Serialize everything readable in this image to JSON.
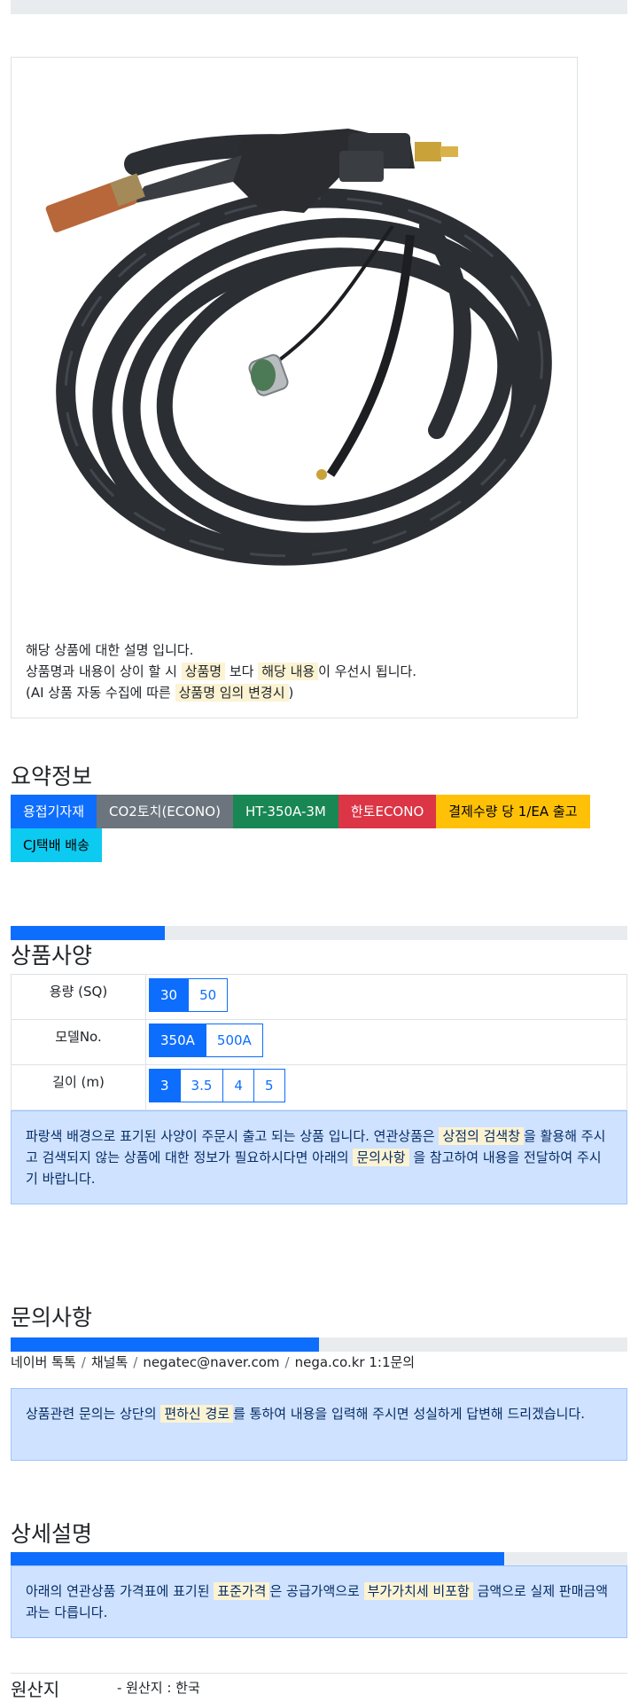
{
  "product": {
    "image_alt": "MIG welding torch with coiled black hose",
    "notice_line1": "해당 상품에 대한 설명 입니다.",
    "notice_line2_pre": "상품명과 내용이 상이 할 시 ",
    "notice_line2_mark1": "상품명",
    "notice_line2_mid": " 보다 ",
    "notice_line2_mark2": "해당 내용",
    "notice_line2_post": "이 우선시 됩니다.",
    "notice_line3_pre": "(AI 상품 자동 수집에 따른 ",
    "notice_line3_mark": "상품명 임의 변경시",
    "notice_line3_post": ")"
  },
  "summary": {
    "title": "요약정보",
    "badges": [
      {
        "label": "용접기자재",
        "color": "#0d6efd"
      },
      {
        "label": "CO2토치(ECONO)",
        "color": "#6c757d"
      },
      {
        "label": "HT-350A-3M",
        "color": "#198754"
      },
      {
        "label": "한토ECONO",
        "color": "#dc3545"
      },
      {
        "label": "결제수량 당 1/EA 출고",
        "color": "#ffc107"
      },
      {
        "label": "CJ택배 배송",
        "color": "#0dcaf0"
      }
    ]
  },
  "spec": {
    "title": "상품사양",
    "progress_fraction": 0.25,
    "rows": [
      {
        "label": "용량 (SQ)",
        "options": [
          "30",
          "50"
        ],
        "selected": "30"
      },
      {
        "label": "모델No.",
        "options": [
          "350A",
          "500A"
        ],
        "selected": "350A"
      },
      {
        "label": "길이 (m)",
        "options": [
          "3",
          "3.5",
          "4",
          "5"
        ],
        "selected": "3"
      }
    ],
    "notice_pre": "파랑색 배경으로 표기된 사양이 주문시 출고 되는 상품 입니다. 연관상품은 ",
    "notice_mark1": "상점의 검색창",
    "notice_mid": "을 활용해 주시고 검색되지 않는 상품에 대한 정보가 필요하시다면 아래의 ",
    "notice_mark2": "문의사항",
    "notice_post": " 을 참고하여 내용을 전달하여 주시기 바랍니다."
  },
  "inquiry": {
    "title": "문의사항",
    "progress_fraction": 0.5,
    "contacts": [
      "네이버 톡톡",
      "채널톡",
      "negatec@naver.com",
      "nega.co.kr 1:1문의"
    ],
    "notice_pre": "상품관련 문의는 상단의 ",
    "notice_mark": "편하신 경로",
    "notice_post": "를 통하여 내용을 입력해 주시면 성실하게 답변해 드리겠습니다."
  },
  "detail": {
    "title": "상세설명",
    "progress_fraction": 0.8,
    "notice_pre": "아래의 연관상품 가격표에 표기된 ",
    "notice_mark1": "표준가격",
    "notice_mid": "은 공급가액으로 ",
    "notice_mark2": "부가가치세 비포함",
    "notice_post": " 금액으로 실제 판매금액과는 다릅니다."
  },
  "origin": {
    "label": "원산지",
    "value": "- 원산지 : 한국"
  },
  "colors": {
    "primary": "#0d6efd",
    "alert_bg": "#cfe2ff",
    "mark_bg": "#fcf3d3",
    "track": "#e9ecef"
  }
}
